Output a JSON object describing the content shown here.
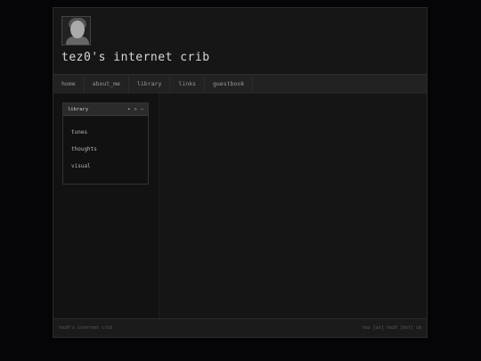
{
  "header": {
    "title": "tez0's internet crib"
  },
  "nav": {
    "items": [
      "home",
      "about_me",
      "library",
      "links",
      "guestbook"
    ]
  },
  "library_window": {
    "title": "library",
    "controls": [
      "•",
      "▫",
      "–"
    ],
    "links": [
      "tunes",
      "thoughts",
      "visual"
    ]
  },
  "footer": {
    "left": "tez0's internet crib",
    "right": "tez [at] tez0 [dot] cm"
  }
}
